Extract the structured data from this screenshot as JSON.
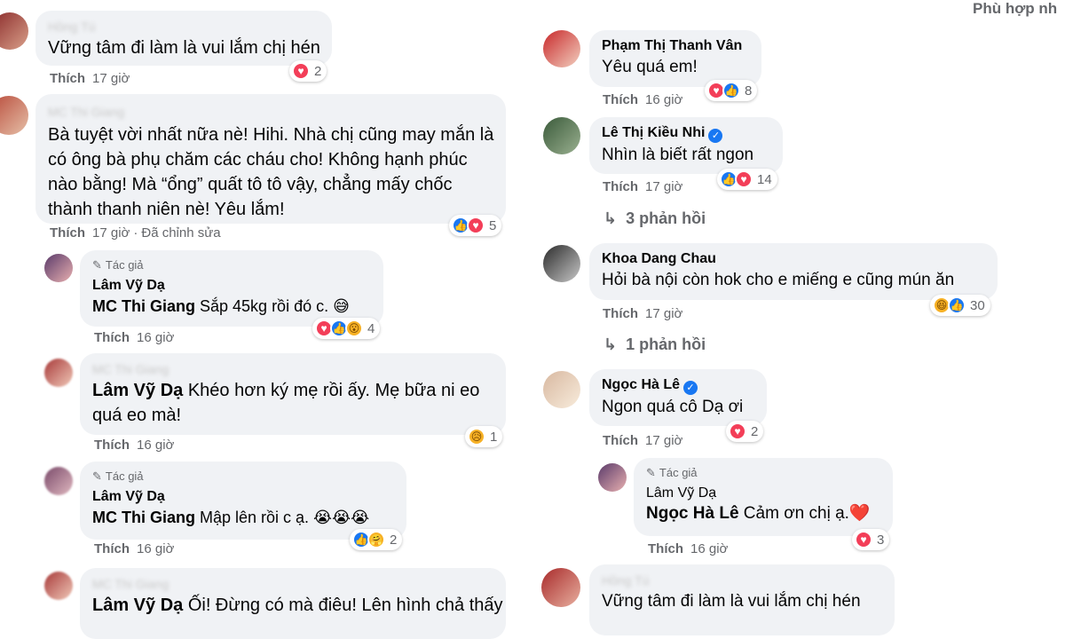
{
  "sort_label": "Phù hợp nh",
  "verified_mark": "✓",
  "reply_arrow": "↳",
  "author_pen": "✎",
  "colors": {
    "bubble": "#f0f2f5",
    "meta": "#65676b",
    "like_blue": "#1877f2",
    "heart_red": "#f33e58"
  },
  "left": [
    {
      "name": "Hồng Tú",
      "text": "Vững tâm đi làm là vui lắm chị hén",
      "like": "Thích",
      "time": "17 giờ",
      "reactions": [
        "heart"
      ],
      "count": "2"
    },
    {
      "name": "MC Thi Giang",
      "lines": [
        "Bà tuyệt vời nhất nữa nè! Hihi. Nhà chị cũng may mắn là",
        "có ông bà phụ chăm các cháu cho! Không hạnh phúc",
        "nào bằng! Mà “ổng” quất tô tô vậy, chẳng mấy chốc",
        "thành thanh niên nè! Yêu lắm!"
      ],
      "like": "Thích",
      "time": "17 giờ",
      "edited": "Đã chỉnh sửa",
      "reactions": [
        "like",
        "heart"
      ],
      "count": "5"
    },
    {
      "author": "Tác giả",
      "name": "Lâm Vỹ Dạ",
      "tag": "MC Thi Giang",
      "text": " Sắp 45kg rồi đó c. 😅",
      "like": "Thích",
      "time": "16 giờ",
      "reactions": [
        "heart",
        "like",
        "wow"
      ],
      "count": "4"
    },
    {
      "name": "MC Thi Giang",
      "tag": "Lâm Vỹ Dạ",
      "lines": [
        " Khéo hơn ký mẹ rồi ấy. Mẹ bữa ni eo",
        "quá eo mà!"
      ],
      "like": "Thích",
      "time": "16 giờ",
      "reactions": [
        "sad"
      ],
      "count": "1"
    },
    {
      "author": "Tác giả",
      "name": "Lâm Vỹ Dạ",
      "tag": "MC Thi Giang",
      "text": " Mập lên rồi c ạ. 😭😭😭",
      "like": "Thích",
      "time": "16 giờ",
      "reactions": [
        "like",
        "care"
      ],
      "count": "2"
    },
    {
      "name": "MC Thi Giang",
      "tag": "Lâm Vỹ Dạ",
      "text": " Ối! Đừng có mà điêu! Lên hình chả thấy"
    }
  ],
  "right": [
    {
      "name": "Phạm Thị Thanh Vân",
      "text": "Yêu quá em!",
      "like": "Thích",
      "time": "16 giờ",
      "reactions": [
        "heart",
        "like"
      ],
      "count": "8"
    },
    {
      "name": "Lê Thị Kiều Nhi",
      "verified": true,
      "text": "Nhìn là biết rất ngon",
      "like": "Thích",
      "time": "17 giờ",
      "reactions": [
        "like",
        "heart"
      ],
      "count": "14",
      "replies": "3 phản hồi"
    },
    {
      "name": "Khoa Dang Chau",
      "text": "Hỏi bà nội còn hok cho e miếng e cũng mún ăn",
      "like": "Thích",
      "time": "17 giờ",
      "reactions": [
        "haha",
        "like"
      ],
      "count": "30",
      "replies": "1 phản hồi"
    },
    {
      "name": "Ngọc Hà Lê",
      "verified": true,
      "text": "Ngon quá cô Dạ ơi",
      "like": "Thích",
      "time": "17 giờ",
      "reactions": [
        "heart"
      ],
      "count": "2"
    },
    {
      "author": "Tác giả",
      "name": "Lâm Vỹ Dạ",
      "tag": "Ngọc Hà Lê",
      "text": " Cảm ơn chị ạ.❤️",
      "like": "Thích",
      "time": "16 giờ",
      "reactions": [
        "heart"
      ],
      "count": "3"
    },
    {
      "name": "Hồng Tú",
      "text": "Vững tâm đi làm là vui lắm chị hén"
    }
  ]
}
